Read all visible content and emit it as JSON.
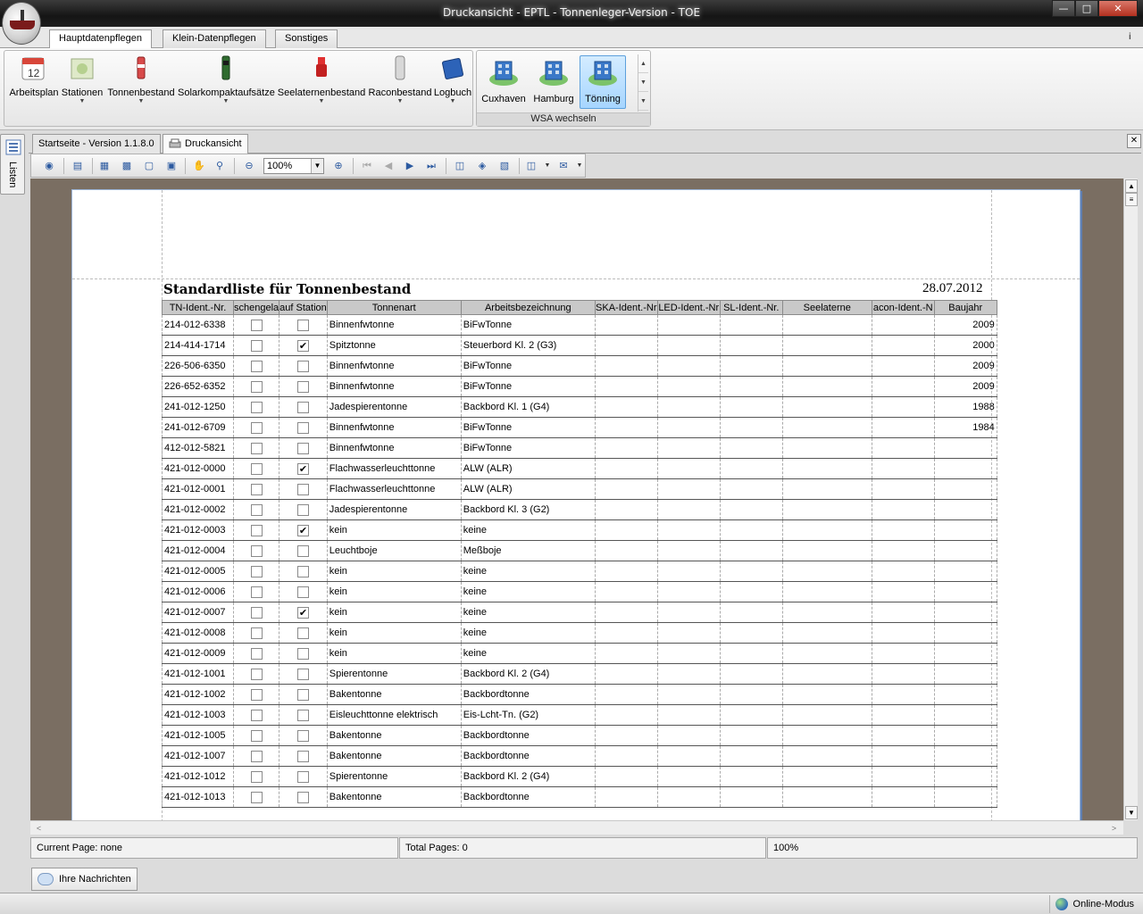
{
  "window": {
    "title": "Druckansicht - EPTL - Tonnenleger-Version - TOE",
    "controls": [
      "minimize",
      "maximize",
      "close"
    ]
  },
  "ribbon_tabs": [
    {
      "label": "Hauptdatenpflegen",
      "active": true
    },
    {
      "label": "Klein-Datenpflegen",
      "active": false
    },
    {
      "label": "Sonstiges",
      "active": false
    }
  ],
  "ribbon_buttons": [
    {
      "label": "Arbeitsplan",
      "icon": "calendar-icon",
      "dropdown": false
    },
    {
      "label": "Stationen",
      "icon": "map-icon",
      "dropdown": true
    },
    {
      "label": "Tonnenbestand",
      "icon": "buoy-red-icon",
      "dropdown": true
    },
    {
      "label": "Solarkompaktaufsätze",
      "icon": "solar-buoy-icon",
      "dropdown": true
    },
    {
      "label": "Seelaternenbestand",
      "icon": "lantern-icon",
      "dropdown": true
    },
    {
      "label": "Raconbestand",
      "icon": "racon-icon",
      "dropdown": true
    },
    {
      "label": "Logbuch",
      "icon": "book-icon",
      "dropdown": true
    }
  ],
  "wsa_group": {
    "label": "WSA wechseln",
    "items": [
      {
        "label": "Cuxhaven",
        "selected": false
      },
      {
        "label": "Hamburg",
        "selected": false
      },
      {
        "label": "Tönning",
        "selected": true
      }
    ]
  },
  "side_panel": {
    "label": "Listen"
  },
  "doc_tabs": [
    {
      "label": "Startseite - Version 1.1.8.0",
      "active": false
    },
    {
      "label": "Druckansicht",
      "active": true
    }
  ],
  "toolbar": {
    "zoom": "100%"
  },
  "report": {
    "title": "Standardliste für Tonnenbestand",
    "date": "28.07.2012",
    "columns": [
      "TN-Ident.-Nr.",
      "schengela",
      "auf Station",
      "Tonnenart",
      "Arbeitsbezeichnung",
      "SKA-Ident.-Nr",
      "LED-Ident.-Nr",
      "SL-Ident.-Nr.",
      "Seelaterne",
      "acon-Ident.-N",
      "Baujahr"
    ],
    "rows": [
      {
        "id": "214-012-6338",
        "c1": false,
        "c2": false,
        "art": "Binnenfwtonne",
        "bez": "BiFwTonne",
        "baujahr": "2009"
      },
      {
        "id": "214-414-1714",
        "c1": false,
        "c2": true,
        "art": "Spitztonne",
        "bez": "Steuerbord Kl. 2 (G3)",
        "baujahr": "2000"
      },
      {
        "id": "226-506-6350",
        "c1": false,
        "c2": false,
        "art": "Binnenfwtonne",
        "bez": "BiFwTonne",
        "baujahr": "2009"
      },
      {
        "id": "226-652-6352",
        "c1": false,
        "c2": false,
        "art": "Binnenfwtonne",
        "bez": "BiFwTonne",
        "baujahr": "2009"
      },
      {
        "id": "241-012-1250",
        "c1": false,
        "c2": false,
        "art": "Jadespierentonne",
        "bez": "Backbord Kl. 1 (G4)",
        "baujahr": "1988"
      },
      {
        "id": "241-012-6709",
        "c1": false,
        "c2": false,
        "art": "Binnenfwtonne",
        "bez": "BiFwTonne",
        "baujahr": "1984"
      },
      {
        "id": "412-012-5821",
        "c1": false,
        "c2": false,
        "art": "Binnenfwtonne",
        "bez": "BiFwTonne",
        "baujahr": ""
      },
      {
        "id": "421-012-0000",
        "c1": false,
        "c2": true,
        "art": "Flachwasserleuchttonne",
        "bez": "ALW (ALR)",
        "baujahr": ""
      },
      {
        "id": "421-012-0001",
        "c1": false,
        "c2": false,
        "art": "Flachwasserleuchttonne",
        "bez": "ALW (ALR)",
        "baujahr": ""
      },
      {
        "id": "421-012-0002",
        "c1": false,
        "c2": false,
        "art": "Jadespierentonne",
        "bez": "Backbord Kl. 3 (G2)",
        "baujahr": ""
      },
      {
        "id": "421-012-0003",
        "c1": false,
        "c2": true,
        "art": "kein",
        "bez": "keine",
        "baujahr": ""
      },
      {
        "id": "421-012-0004",
        "c1": false,
        "c2": false,
        "art": "Leuchtboje",
        "bez": "Meßboje",
        "baujahr": ""
      },
      {
        "id": "421-012-0005",
        "c1": false,
        "c2": false,
        "art": "kein",
        "bez": "keine",
        "baujahr": ""
      },
      {
        "id": "421-012-0006",
        "c1": false,
        "c2": false,
        "art": "kein",
        "bez": "keine",
        "baujahr": ""
      },
      {
        "id": "421-012-0007",
        "c1": false,
        "c2": true,
        "art": "kein",
        "bez": "keine",
        "baujahr": ""
      },
      {
        "id": "421-012-0008",
        "c1": false,
        "c2": false,
        "art": "kein",
        "bez": "keine",
        "baujahr": ""
      },
      {
        "id": "421-012-0009",
        "c1": false,
        "c2": false,
        "art": "kein",
        "bez": "keine",
        "baujahr": ""
      },
      {
        "id": "421-012-1001",
        "c1": false,
        "c2": false,
        "art": "Spierentonne",
        "bez": "Backbord Kl. 2 (G4)",
        "baujahr": ""
      },
      {
        "id": "421-012-1002",
        "c1": false,
        "c2": false,
        "art": "Bakentonne",
        "bez": "Backbordtonne",
        "baujahr": ""
      },
      {
        "id": "421-012-1003",
        "c1": false,
        "c2": false,
        "art": "Eisleuchttonne elektrisch",
        "bez": "Eis-Lcht-Tn. (G2)",
        "baujahr": ""
      },
      {
        "id": "421-012-1005",
        "c1": false,
        "c2": false,
        "art": "Bakentonne",
        "bez": "Backbordtonne",
        "baujahr": ""
      },
      {
        "id": "421-012-1007",
        "c1": false,
        "c2": false,
        "art": "Bakentonne",
        "bez": "Backbordtonne",
        "baujahr": ""
      },
      {
        "id": "421-012-1012",
        "c1": false,
        "c2": false,
        "art": "Spierentonne",
        "bez": "Backbord Kl. 2 (G4)",
        "baujahr": ""
      },
      {
        "id": "421-012-1013",
        "c1": false,
        "c2": false,
        "art": "Bakentonne",
        "bez": "Backbordtonne",
        "baujahr": ""
      }
    ]
  },
  "status": {
    "current_page": "Current Page: none",
    "total_pages": "Total Pages: 0",
    "zoom": "100%"
  },
  "messages_tab": "Ihre Nachrichten",
  "app_status": "Online-Modus",
  "colors": {
    "accent": "#5da0dc",
    "preview_bg": "#7a6e62",
    "header_bg": "#c9c9c9"
  }
}
